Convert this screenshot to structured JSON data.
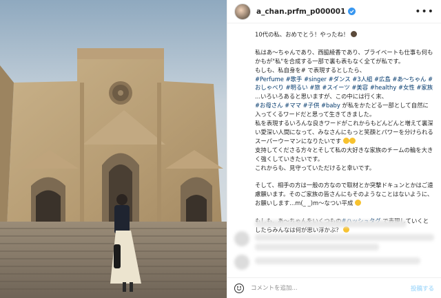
{
  "post": {
    "username": "a_chan.prfm_p000001",
    "more_label": "•••",
    "photo_alt": "Woman standing on steps in front of a cathedral",
    "caption": {
      "line1": "10代の私、おめでとう！やったね！",
      "line2": "私はあ〜ちゃんであり、西脇綾香であり、プライベートも仕事も何もかもが\"私\"を合成する一部で裏も表もなく全てが私です。",
      "line3": "もしも、私自身を# で表現するとしたら、",
      "tags1": "#Perfume #歌手 #singer #ダンス #3人組 #広島 #あ〜ちゃん #おしゃべり #明るい #旅 #スイーツ #美容 #healthy #女性 #家族",
      "line4": " ...いろいろあると思いますが、この中には行く末、",
      "tags2": "#お母さん #ママ #子供 #baby",
      "line5": " が私をかたどる一部として自然に入ってくるワードだと思って生きてきました。",
      "line6": "私を表現するいろんな良きワードがこれからもどんどんと増えて裏深い愛深い人間になって、みなさんにもっと笑顔とパワーを分けられるスーパーウーマンになりたいです",
      "line7": "支持してくださる方々とそして私の大好きな家族のチームの輪を大きく強くしていきたいです。",
      "line8": "これからも、見守っていただけると幸いです。",
      "line9": "そして、相手の方は一般の方なので取材とか突撃ドキュンとかはご遠慮願います。そのご家族の皆さんにもそのようなことはないように、お願いします...m(_ _)m〜なつい平成",
      "line10a": "もしも、あ〜ちゃんをいくつもの",
      "tag_hashtag": "#ハッシュタグ",
      "line10b": " で表現していくとしたらみんなは何が思い浮かぶ？"
    },
    "comment": {
      "placeholder": "コメントを追加...",
      "post_label": "投稿する"
    }
  }
}
